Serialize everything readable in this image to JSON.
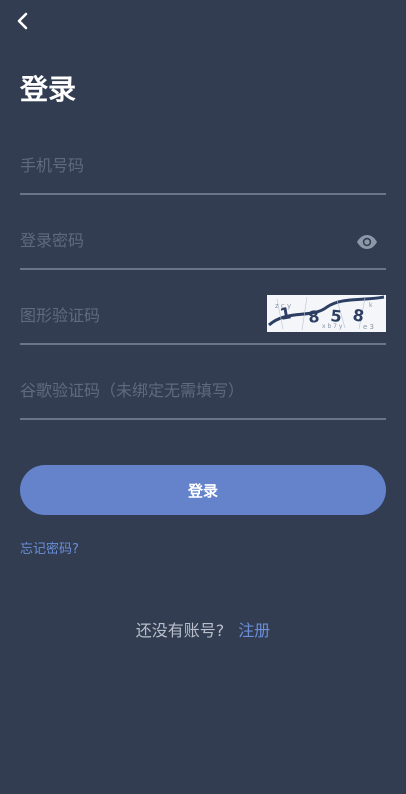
{
  "header": {
    "back_icon": "chevron-left-icon",
    "title": "登录"
  },
  "form": {
    "phone": {
      "placeholder": "手机号码",
      "value": ""
    },
    "password": {
      "placeholder": "登录密码",
      "value": "",
      "toggle_icon": "eye-icon"
    },
    "captcha": {
      "placeholder": "图形验证码",
      "value": "",
      "image_text": "1858"
    },
    "google_code": {
      "placeholder": "谷歌验证码（未绑定无需填写）",
      "value": ""
    },
    "submit_label": "登录",
    "forgot_label": "忘记密码?"
  },
  "footer": {
    "prompt": "还没有账号?",
    "register_label": "注册"
  },
  "colors": {
    "background": "#323d52",
    "accent": "#6483cb",
    "link": "#6a8fd8",
    "divider": "#6b7587",
    "placeholder": "#5e6a7e"
  }
}
